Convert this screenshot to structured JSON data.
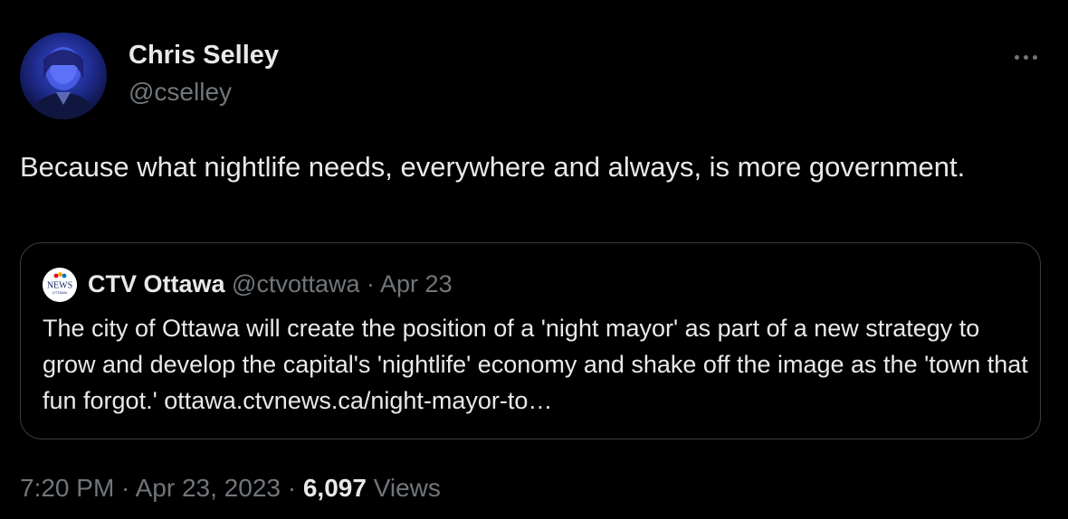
{
  "author": {
    "name": "Chris Selley",
    "handle": "@cselley"
  },
  "tweet": {
    "text": "Because what nightlife needs, everywhere and always, is more government."
  },
  "quote": {
    "name": "CTV Ottawa",
    "handle": "@ctvottawa",
    "separator": " · ",
    "date": "Apr 23",
    "text": "The city of Ottawa will create the position of a 'night mayor' as part of a new strategy to grow and develop the capital's 'nightlife' economy and shake off the image as the 'town that fun forgot.'  ",
    "link": "ottawa.ctvnews.ca/night-mayor-to…",
    "logo_text": "NEWS",
    "logo_subtext": "OTTAWA"
  },
  "footer": {
    "time": "7:20 PM",
    "separator": " · ",
    "date": "Apr 23, 2023",
    "views_count": "6,097",
    "views_label": "Views"
  },
  "icons": {
    "more": "more-options-icon"
  },
  "colors": {
    "background": "#000000",
    "text_primary": "#e7e9ea",
    "text_secondary": "#71767b",
    "border": "#3a3d41"
  }
}
